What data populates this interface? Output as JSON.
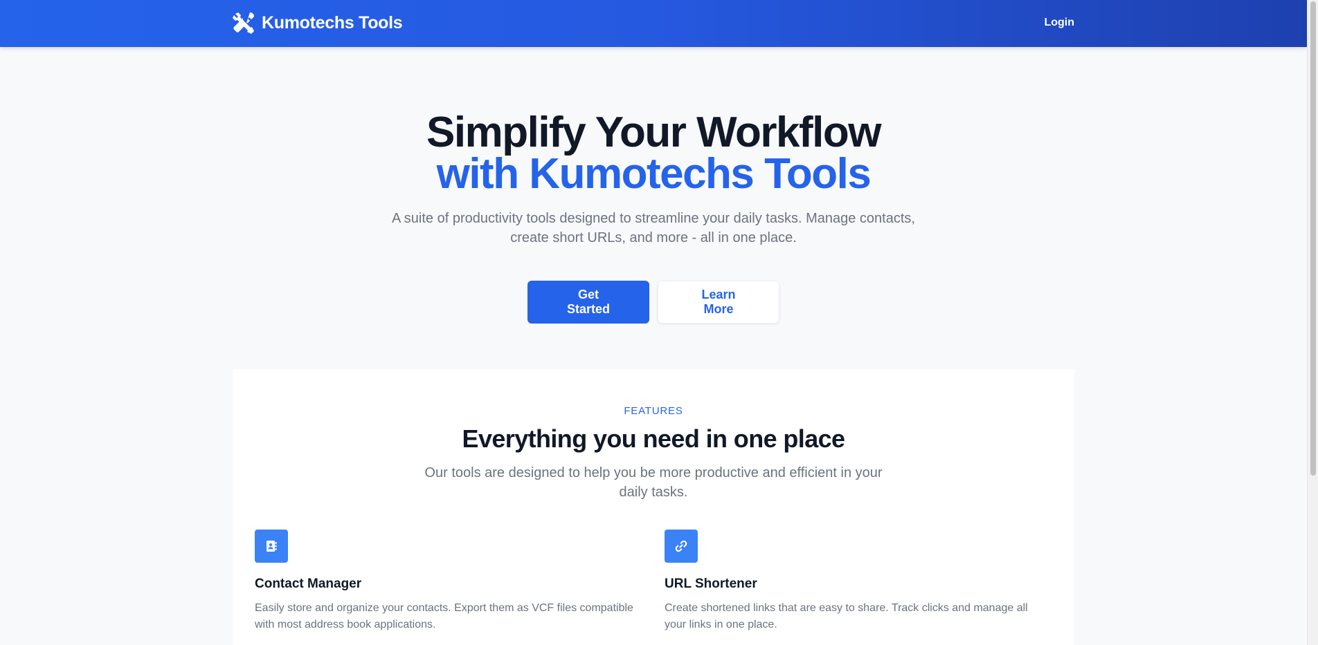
{
  "header": {
    "brand_name": "Kumotechs Tools",
    "brand_icon": "tools-icon",
    "login_label": "Login",
    "gradient_start": "#2563eb",
    "gradient_end": "#1e40af"
  },
  "hero": {
    "title_line1": "Simplify Your Workflow",
    "title_line2": "with Kumotechs Tools",
    "subtitle": "A suite of productivity tools designed to streamline your daily tasks. Manage contacts, create short URLs, and more - all in one place.",
    "primary_button": "Get Started",
    "secondary_button": "Learn More"
  },
  "features": {
    "eyebrow": "FEATURES",
    "title": "Everything you need in one place",
    "subtitle": "Our tools are designed to help you be more productive and efficient in your daily tasks.",
    "items": [
      {
        "icon": "address-book-icon",
        "name": "Contact Manager",
        "description": "Easily store and organize your contacts. Export them as VCF files compatible with most address book applications."
      },
      {
        "icon": "link-icon",
        "name": "URL Shortener",
        "description": "Create shortened links that are easy to share. Track clicks and manage all your links in one place."
      }
    ]
  },
  "colors": {
    "accent": "#2563eb",
    "icon_bg": "#3b82f6",
    "heading": "#111827",
    "muted": "#6b7280",
    "page_bg": "#f8f9fb"
  }
}
